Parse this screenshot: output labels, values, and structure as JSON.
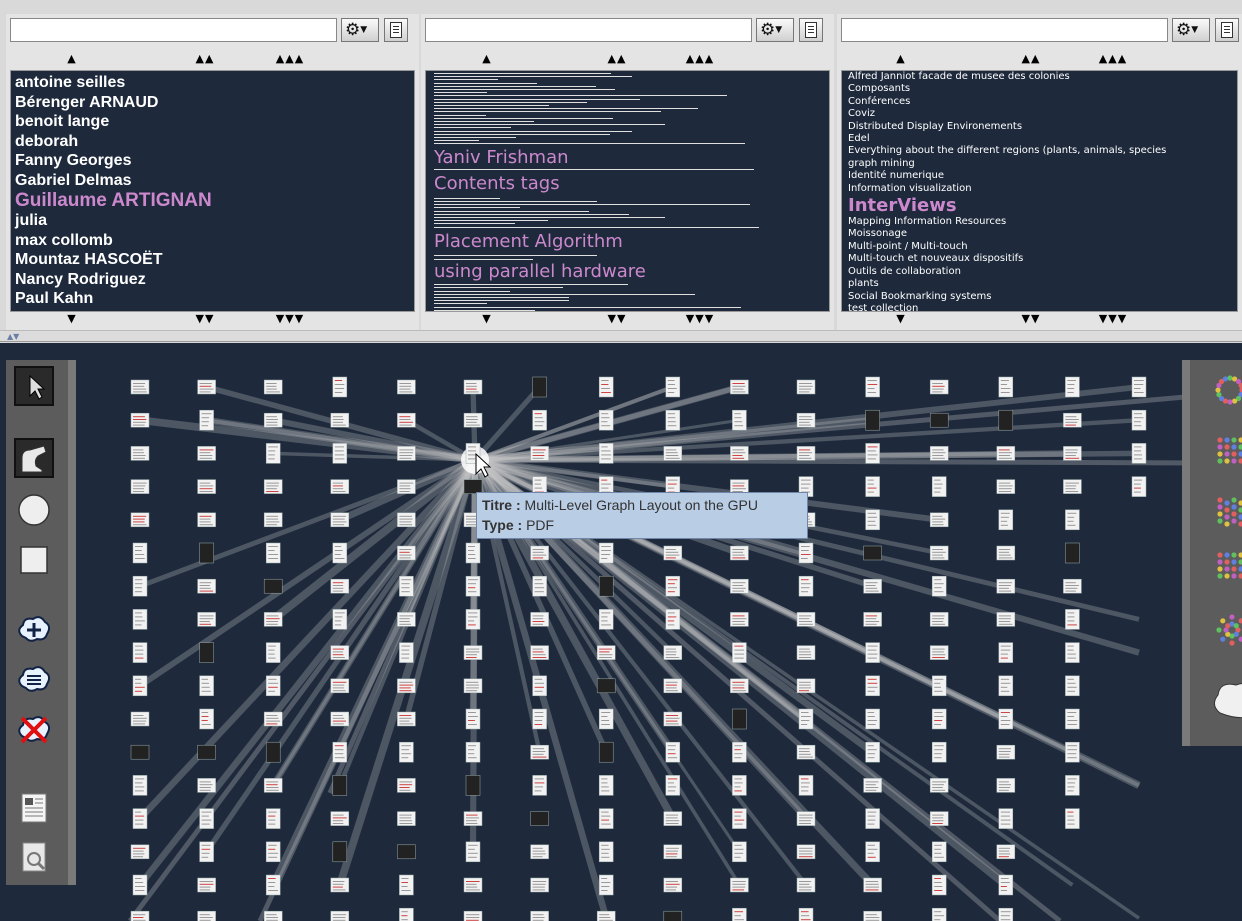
{
  "panels": {
    "arrows_up": [
      "▲",
      "▲▲",
      "▲▲▲"
    ],
    "arrows_down": [
      "▼",
      "▼▼",
      "▼▼▼"
    ],
    "authors": {
      "search_value": "",
      "items": [
        {
          "label": "antoine seilles",
          "highlight": false
        },
        {
          "label": "Bérenger ARNAUD",
          "highlight": false
        },
        {
          "label": "benoit lange",
          "highlight": false
        },
        {
          "label": "deborah",
          "highlight": false
        },
        {
          "label": "Fanny Georges",
          "highlight": false
        },
        {
          "label": "Gabriel Delmas",
          "highlight": false
        },
        {
          "label": "Guillaume ARTIGNAN",
          "highlight": true
        },
        {
          "label": "julia",
          "highlight": false
        },
        {
          "label": "max collomb",
          "highlight": false
        },
        {
          "label": "Mountaz HASCOËT",
          "highlight": false
        },
        {
          "label": "Nancy Rodriguez",
          "highlight": false
        },
        {
          "label": "Paul Kahn",
          "highlight": false
        }
      ]
    },
    "keywords": {
      "search_value": "",
      "highlighted": [
        "Yaniv Frishman",
        "Contents tags",
        "Placement Algorithm",
        "using parallel hardware"
      ]
    },
    "collections": {
      "search_value": "",
      "items": [
        {
          "label": "Alfred Janniot facade de musee des colonies",
          "highlight": false
        },
        {
          "label": "Composants",
          "highlight": false
        },
        {
          "label": "Conférences",
          "highlight": false
        },
        {
          "label": "Coviz",
          "highlight": false
        },
        {
          "label": "Distributed Display Environements",
          "highlight": false
        },
        {
          "label": "Edel",
          "highlight": false
        },
        {
          "label": "Everything about the different regions (plants, animals, species",
          "highlight": false
        },
        {
          "label": "graph mining",
          "highlight": false
        },
        {
          "label": "Identité numerique",
          "highlight": false
        },
        {
          "label": "Information visualization",
          "highlight": false
        },
        {
          "label": "InterViews",
          "highlight": true
        },
        {
          "label": "Mapping Information Resources",
          "highlight": false
        },
        {
          "label": "Moissonage",
          "highlight": false
        },
        {
          "label": "Multi-point / Multi-touch",
          "highlight": false
        },
        {
          "label": "Multi-touch et nouveaux dispositifs",
          "highlight": false
        },
        {
          "label": "Outils de collaboration",
          "highlight": false
        },
        {
          "label": "plants",
          "highlight": false
        },
        {
          "label": "Social Bookmarking systems",
          "highlight": false
        },
        {
          "label": "test collection",
          "highlight": false
        }
      ]
    }
  },
  "left_toolbar": [
    "select-arrow-icon",
    "lasso-icon",
    "circle-icon",
    "square-icon",
    "cloud-add-icon",
    "cloud-filter-icon",
    "cloud-delete-icon",
    "document-view-icon",
    "document-search-icon"
  ],
  "right_toolbar": [
    "radial-layout-icon",
    "grid-layout-icon",
    "cluster-layout-icon",
    "grid-cluster-layout-icon",
    "star-layout-icon",
    "cloud-shape-icon"
  ],
  "tooltip": {
    "title_label": "Titre :",
    "title_value": "Multi-Level Graph Layout on the GPU",
    "type_label": "Type :",
    "type_value": "PDF"
  },
  "colors": {
    "canvas_bg": "#1e2a3c",
    "highlight": "#cc88cc",
    "toolbar_bg": "#5c5c5c",
    "tooltip_bg": "#b9cde5"
  }
}
